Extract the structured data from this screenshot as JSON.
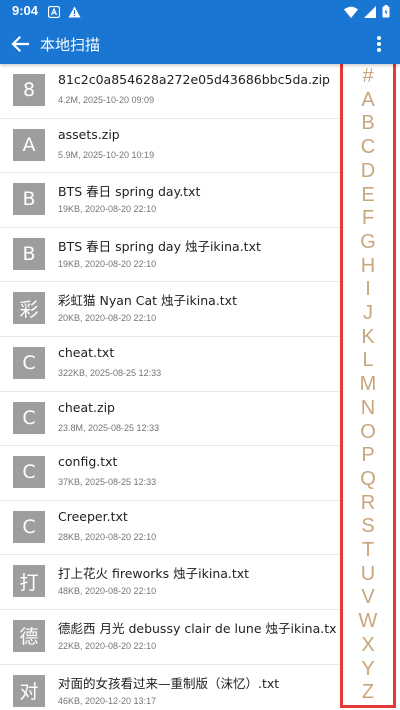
{
  "status_bar": {
    "time": "9:04",
    "background": "#1976d2"
  },
  "app_bar": {
    "title": "本地扫描",
    "back_icon": "arrow-left-icon",
    "menu_icon": "more-vert-icon"
  },
  "files": [
    {
      "thumb": "8",
      "name": "81c2c0a854628a272e05d43686bbc5da.zip",
      "meta": "4.2M, 2025-10-20 09:09"
    },
    {
      "thumb": "A",
      "name": "assets.zip",
      "meta": "5.9M, 2025-10-20 10:19"
    },
    {
      "thumb": "B",
      "name": "BTS 春日 spring day.txt",
      "meta": "19KB, 2020-08-20 22:10"
    },
    {
      "thumb": "B",
      "name": "BTS 春日 spring day 烛子ikina.txt",
      "meta": "19KB, 2020-08-20 22:10"
    },
    {
      "thumb": "彩",
      "name": "彩虹猫 Nyan Cat 烛子ikina.txt",
      "meta": "20KB, 2020-08-20 22:10"
    },
    {
      "thumb": "C",
      "name": "cheat.txt",
      "meta": "322KB, 2025-08-25 12:33"
    },
    {
      "thumb": "C",
      "name": "cheat.zip",
      "meta": "23.8M, 2025-08-25 12:33"
    },
    {
      "thumb": "C",
      "name": "config.txt",
      "meta": "37KB, 2025-08-25 12:33"
    },
    {
      "thumb": "C",
      "name": "Creeper.txt",
      "meta": "28KB, 2020-08-20 22:10"
    },
    {
      "thumb": "打",
      "name": "打上花火 fireworks 烛子ikina.txt",
      "meta": "48KB, 2020-08-20 22:10"
    },
    {
      "thumb": "德",
      "name": "德彪西 月光 debussy clair de lune 烛子ikina.txt",
      "meta": "22KB, 2020-08-20 22:10"
    },
    {
      "thumb": "对",
      "name": "对面的女孩看过来—重制版（沫忆）.txt",
      "meta": "46KB, 2020-12-20 13:17"
    }
  ],
  "index_letters": [
    "#",
    "A",
    "B",
    "C",
    "D",
    "E",
    "F",
    "G",
    "H",
    "I",
    "J",
    "K",
    "L",
    "M",
    "N",
    "O",
    "P",
    "Q",
    "R",
    "S",
    "T",
    "U",
    "V",
    "W",
    "X",
    "Y",
    "Z"
  ],
  "colors": {
    "accent": "#1976d2",
    "thumb": "#9e9e9e",
    "index_letter": "#c9a57c",
    "highlight_border": "#e53935"
  }
}
